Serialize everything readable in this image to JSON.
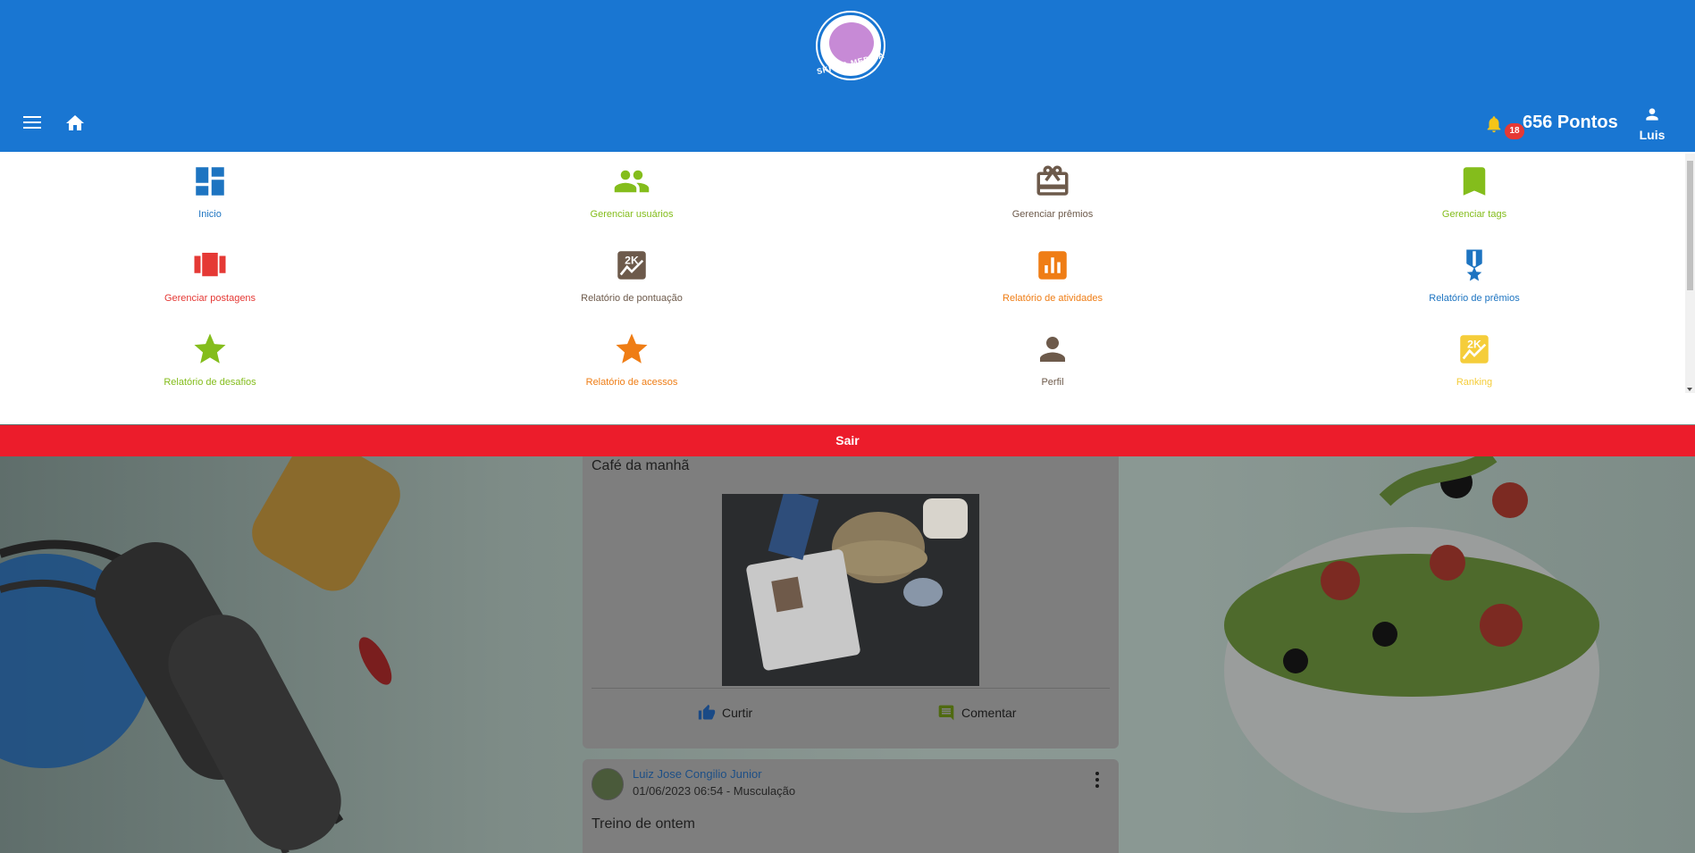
{
  "header": {
    "logo_text": "SKF NA MEDIDA",
    "notifications_count": "18",
    "points_label": "656 Pontos",
    "user_label": "Luis"
  },
  "drawer": {
    "items": [
      {
        "label": "Inicio",
        "color": "#1d74c1",
        "icon": "dashboard-icon"
      },
      {
        "label": "Gerenciar usuários",
        "color": "#84bd1c",
        "icon": "group-icon"
      },
      {
        "label": "Gerenciar prêmios",
        "color": "#6d5a4b",
        "icon": "gift-card-icon"
      },
      {
        "label": "Gerenciar tags",
        "color": "#84bd1c",
        "icon": "bookmark-icon"
      },
      {
        "label": "Gerenciar postagens",
        "color": "#e53935",
        "icon": "carousel-icon"
      },
      {
        "label": "Relatório de pontuação",
        "color": "#6d5a4b",
        "icon": "2k-chart-icon"
      },
      {
        "label": "Relatório de atividades",
        "color": "#ef7d15",
        "icon": "bar-chart-icon"
      },
      {
        "label": "Relatório de prêmios",
        "color": "#1d74c1",
        "icon": "military-medal-icon"
      },
      {
        "label": "Relatório de desafios",
        "color": "#84bd1c",
        "icon": "star-icon"
      },
      {
        "label": "Relatório de acessos",
        "color": "#ef7d15",
        "icon": "star-icon"
      },
      {
        "label": "Perfil",
        "color": "#6d5a4b",
        "icon": "person-icon"
      },
      {
        "label": "Ranking",
        "color": "#f5cd3a",
        "icon": "2k-chart-icon"
      }
    ],
    "logout_label": "Sair"
  },
  "feed": {
    "post1": {
      "caption": "Café da manhã",
      "like_label": "Curtir",
      "comment_label": "Comentar"
    },
    "post2": {
      "author": "Luiz Jose Congilio Junior",
      "meta": "01/06/2023 06:54 - Musculação",
      "caption": "Treino de ontem"
    }
  },
  "colors": {
    "header_bg": "#1976d2",
    "logout_bg": "#ec1c2b"
  }
}
